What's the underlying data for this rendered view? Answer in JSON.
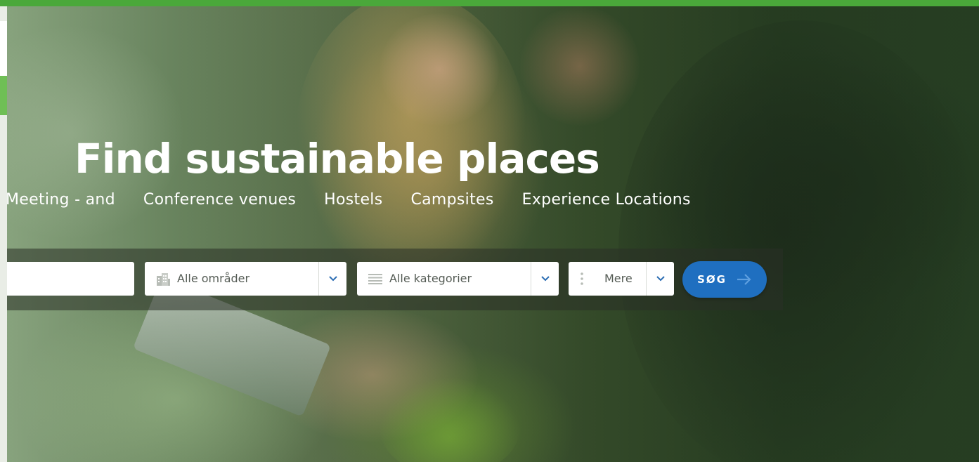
{
  "page": {
    "headline": "Find sustainable places",
    "categories": [
      {
        "label": "Meeting - and"
      },
      {
        "label": "Conference venues"
      },
      {
        "label": "Hostels"
      },
      {
        "label": "Campsites"
      },
      {
        "label": "Experience Locations"
      }
    ]
  },
  "search": {
    "text_value": "",
    "area": {
      "label": "Alle områder",
      "icon": "building-icon"
    },
    "category": {
      "label": "Alle kategorier",
      "icon": "list-icon"
    },
    "more": {
      "label": "Mere",
      "icon": "dots-icon"
    },
    "button": {
      "label": "SØG",
      "icon": "arrow-right-icon"
    }
  },
  "colors": {
    "topbar": "#4aa83a",
    "accent_button": "#1f6fc0",
    "left_tab_green": "#6fbf55"
  }
}
